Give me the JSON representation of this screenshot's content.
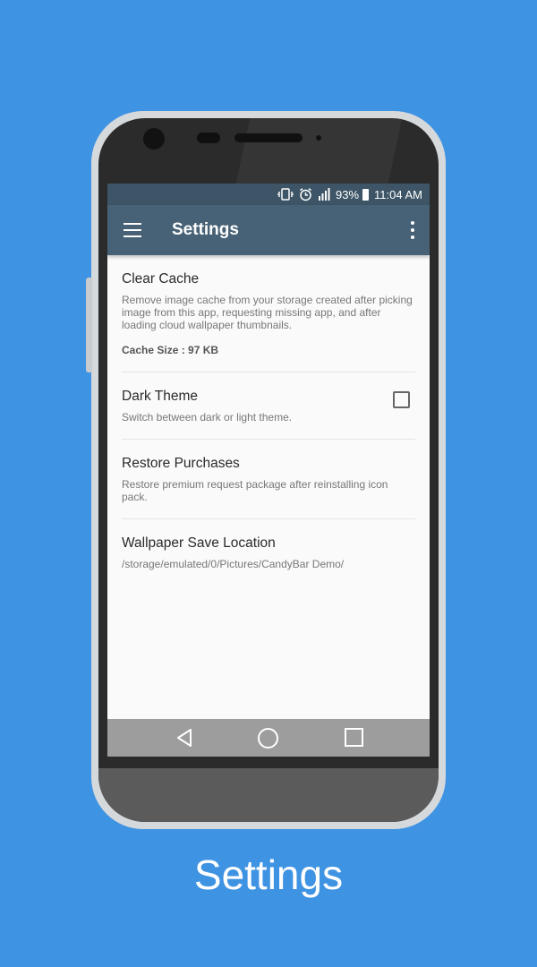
{
  "status_bar": {
    "battery_percent": "93%",
    "time": "11:04 AM"
  },
  "toolbar": {
    "title": "Settings"
  },
  "settings": [
    {
      "title": "Clear Cache",
      "summary": "Remove image cache from your storage created after picking image from this app, requesting missing app, and after loading cloud wallpaper thumbnails.",
      "extra": "Cache Size : 97 KB"
    },
    {
      "title": "Dark Theme",
      "summary": "Switch between dark or light theme.",
      "checked": false
    },
    {
      "title": "Restore Purchases",
      "summary": "Restore premium request package after reinstalling icon pack."
    },
    {
      "title": "Wallpaper Save Location",
      "summary": "/storage/emulated/0/Pictures/CandyBar Demo/"
    }
  ],
  "caption": "Settings",
  "colors": {
    "background": "#3f93e3",
    "status_bar": "#3d5566",
    "toolbar": "#476276",
    "screen": "#fafafa",
    "nav_bar": "#9d9d9d"
  },
  "icons": [
    "vibrate-icon",
    "alarm-icon",
    "signal-icon",
    "battery-icon",
    "menu-icon",
    "overflow-menu-icon",
    "back-icon",
    "home-icon",
    "recent-apps-icon"
  ]
}
